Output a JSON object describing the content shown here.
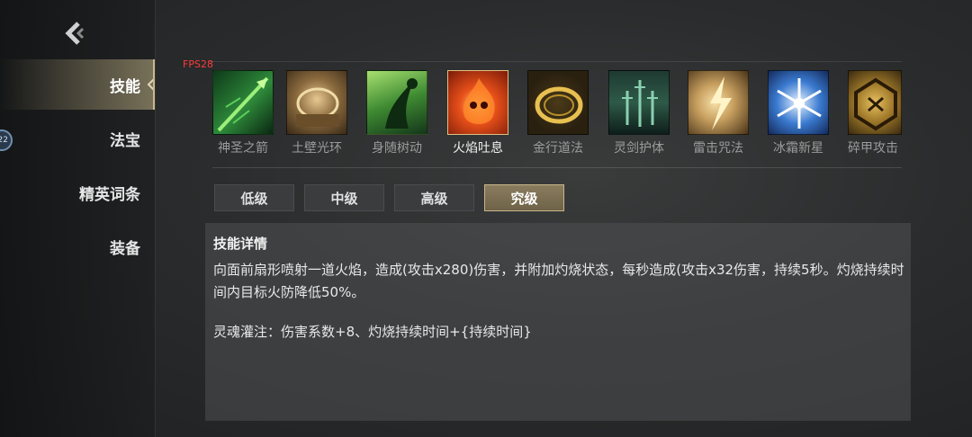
{
  "nav": {
    "items": [
      {
        "label": "技能",
        "active": true
      },
      {
        "label": "法宝",
        "active": false
      },
      {
        "label": "精英词条",
        "active": false
      },
      {
        "label": "装备",
        "active": false
      }
    ],
    "badge": "22"
  },
  "overlay": {
    "fps": "FPS28"
  },
  "skills": [
    {
      "label": "神圣之箭",
      "icon": "holy-arrow-icon",
      "color": "#2e8a3a",
      "selected": false
    },
    {
      "label": "土壁光环",
      "icon": "earth-wall-aura-icon",
      "color": "#8a6a3e",
      "selected": false
    },
    {
      "label": "身随树动",
      "icon": "tree-step-icon",
      "color": "#3e8a32",
      "selected": false
    },
    {
      "label": "火焰吐息",
      "icon": "flame-breath-icon",
      "color": "#d84a18",
      "selected": true
    },
    {
      "label": "金行道法",
      "icon": "metal-ring-icon",
      "color": "#b8902a",
      "selected": false
    },
    {
      "label": "灵剑护体",
      "icon": "spirit-swords-icon",
      "color": "#2e5a48",
      "selected": false
    },
    {
      "label": "雷击咒法",
      "icon": "thunder-curse-icon",
      "color": "#c8a060",
      "selected": false
    },
    {
      "label": "冰霜新星",
      "icon": "frost-nova-icon",
      "color": "#3a7ad0",
      "selected": false
    },
    {
      "label": "碎甲攻击",
      "icon": "armor-break-icon",
      "color": "#a07a2a",
      "selected": false
    }
  ],
  "tabs": [
    {
      "label": "低级",
      "active": false
    },
    {
      "label": "中级",
      "active": false
    },
    {
      "label": "高级",
      "active": false
    },
    {
      "label": "究级",
      "active": true
    }
  ],
  "detail": {
    "title": "技能详情",
    "description": "向面前扇形喷射一道火焰，造成(攻击x280)伤害，并附加灼烧状态，每秒造成(攻击x32伤害，持续5秒。灼烧持续时间内目标火防降低50%。",
    "soul": "灵魂灌注：伤害系数+8、灼烧持续时间+{持续时间}"
  }
}
